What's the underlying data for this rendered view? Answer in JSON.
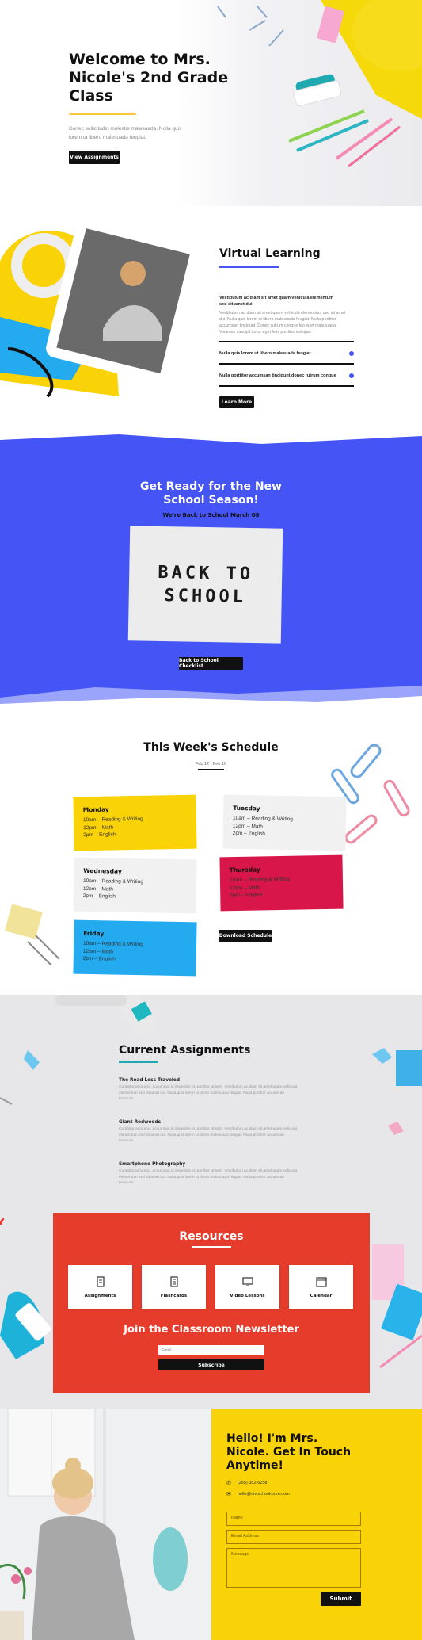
{
  "hero": {
    "title_line1": "Welcome to Mrs.",
    "title_line2": "Nicole's 2nd Grade",
    "title_line3": "Class",
    "text_line1": "Donec sollicitudin molestie malesuada. Nulla quis",
    "text_line2": "lorem ut libero malesuada feugiat.",
    "button": "View Assignments"
  },
  "virtual": {
    "title": "Virtual Learning",
    "intro_line1": "Vestibulum ac diam sit amet quam vehicula elementum",
    "intro_line2": "sed sit amet dui.",
    "body_line1": "Vestibulum ac diam sit amet quam vehicula elementum sed sit amet",
    "body_line2": "dui. Nulla quis lorem ut libero malesuada feugiat. Nulla porttitor",
    "body_line3": "accumsan tincidunt. Donec rutrum congue leo eget malesuada.",
    "body_line4": "Vivamus suscipit tortor eget felis porttitor volutpat.",
    "accordion": [
      {
        "label": "Nulla quis lorem ut libero malesuada feugiat"
      },
      {
        "label": "Nulla porttitor accumsan tincidunt donec rutrum congue"
      }
    ],
    "button": "Learn More"
  },
  "season": {
    "title_line1": "Get Ready for the New",
    "title_line2": "School Season!",
    "subtitle": "We're Back to School March 08",
    "sign_line1": "BACK TO",
    "sign_line2": "SCHOOL",
    "button": "Back to School Checklist"
  },
  "schedule": {
    "title": "This Week's Schedule",
    "dates": "Feb 12 - Feb 16",
    "days": [
      {
        "day": "Monday",
        "l1": "10am – Reading & Writing",
        "l2": "12pm – Math",
        "l3": "2pm – English"
      },
      {
        "day": "Tuesday",
        "l1": "10am – Reading & Writing",
        "l2": "12pm – Math",
        "l3": "2pm – English"
      },
      {
        "day": "Wednesday",
        "l1": "10am – Reading & Writing",
        "l2": "12pm – Math",
        "l3": "2pm – English"
      },
      {
        "day": "Thursday",
        "l1": "10am – Reading & Writing",
        "l2": "12pm – Math",
        "l3": "2pm – English"
      },
      {
        "day": "Friday",
        "l1": "10am – Reading & Writing",
        "l2": "12pm – Math",
        "l3": "2pm – English"
      }
    ],
    "button": "Download Schedule"
  },
  "assignments": {
    "title": "Current Assignments",
    "items": [
      {
        "title": "The Road Less Traveled",
        "l1": "Curabitur arcu erat, accumsan id imperdiet et, porttitor at sem. Vestibulum ac diam sit amet quam vehicula",
        "l2": "elementum sed sit amet dui. Nulla quis lorem ut libero malesuada feugiat. Nulla porttitor accumsan",
        "l3": "tincidunt."
      },
      {
        "title": "Giant Redwoods",
        "l1": "Curabitur arcu erat, accumsan id imperdiet et, porttitor at sem. Vestibulum ac diam sit amet quam vehicula",
        "l2": "elementum sed sit amet dui. Nulla quis lorem ut libero malesuada feugiat. Nulla porttitor accumsan",
        "l3": "tincidunt."
      },
      {
        "title": "Smartphone Photography",
        "l1": "Curabitur arcu erat, accumsan id imperdiet et, porttitor at sem. Vestibulum ac diam sit amet quam vehicula",
        "l2": "elementum sed sit amet dui. Nulla quis lorem ut libero malesuada feugiat. Nulla porttitor accumsan",
        "l3": "tincidunt."
      }
    ]
  },
  "resources": {
    "title": "Resources",
    "cards": [
      {
        "label": "Assignments",
        "icon": "assignment-icon"
      },
      {
        "label": "Flashcards",
        "icon": "flashcard-icon"
      },
      {
        "label": "Video Lessons",
        "icon": "video-icon"
      },
      {
        "label": "Calendar",
        "icon": "calendar-icon"
      }
    ],
    "newsletter_title": "Join the Classroom Newsletter",
    "email_placeholder": "Email",
    "subscribe": "Subscribe"
  },
  "contact": {
    "title_line1": "Hello! I'm Mrs.",
    "title_line2": "Nicole. Get In Touch",
    "title_line3": "Anytime!",
    "phone": "(255) 352-6258",
    "email": "hello@divischoolroom.com",
    "name_placeholder": "Name",
    "email_placeholder": "Email Address",
    "message_placeholder": "Message",
    "submit": "Submit"
  },
  "colors": {
    "blue": "#4454f5",
    "yellow": "#f9d208",
    "red": "#e63c2c",
    "crimson": "#d8164a",
    "sky": "#24aaee",
    "black": "#111111"
  }
}
